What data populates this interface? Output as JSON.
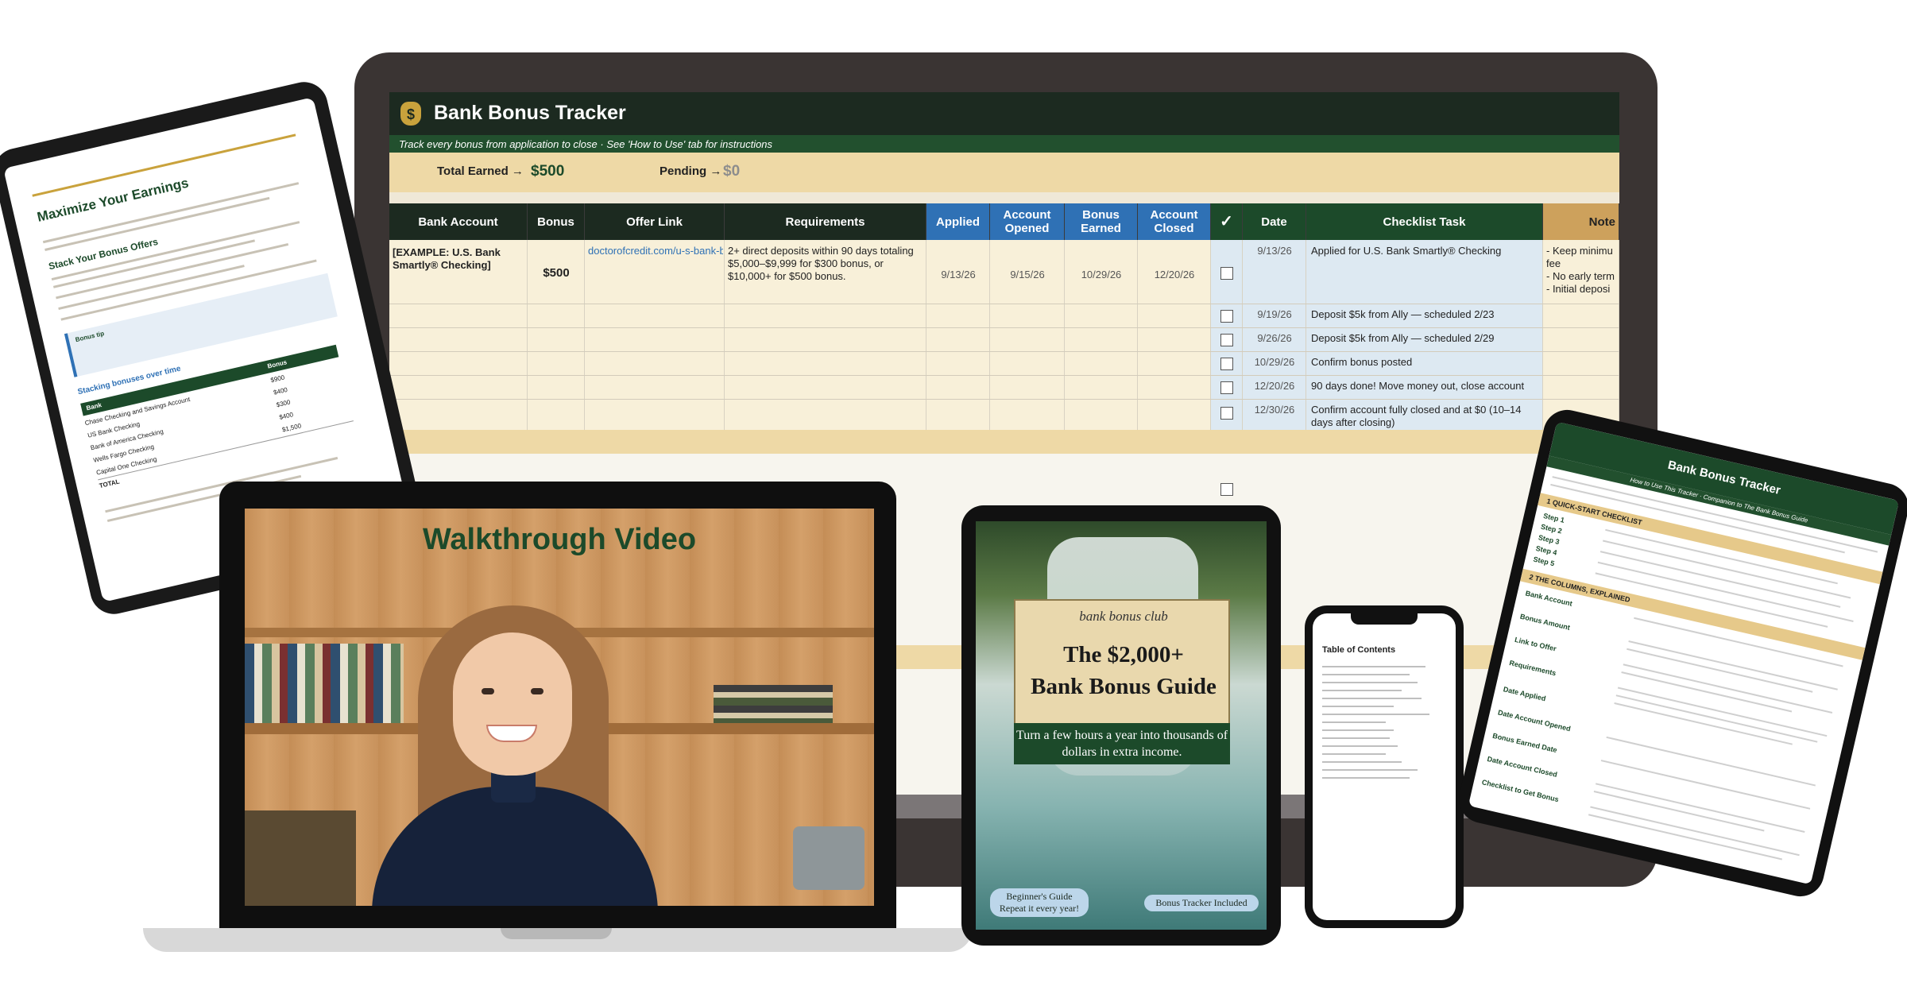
{
  "tracker": {
    "title": "Bank Bonus Tracker",
    "subtitle": "Track every bonus from application to close  ·  See 'How to Use' tab for instructions",
    "total_earned_label": "Total Earned →",
    "total_earned_value": "$500",
    "pending_label": "Pending →",
    "pending_value": "$0",
    "headers": {
      "bank_account": "Bank Account",
      "bonus": "Bonus",
      "offer_link": "Offer Link",
      "requirements": "Requirements",
      "applied": "Applied",
      "account_opened": "Account Opened",
      "bonus_earned": "Bonus Earned",
      "account_closed": "Account Closed",
      "check": "✓",
      "date": "Date",
      "checklist_task": "Checklist Task",
      "notes": "Note"
    },
    "example_row": {
      "bank_account": "[EXAMPLE: U.S. Bank Smartly® Checking]",
      "bonus": "$500",
      "offer_link": "doctorofcredit.com/u-s-bank-b",
      "requirements": "2+ direct deposits within 90 days totaling $5,000–$9,999 for $300 bonus, or $10,000+ for $500 bonus.",
      "applied": "9/13/26",
      "account_opened": "9/15/26",
      "bonus_earned": "10/29/26",
      "account_closed": "12/20/26",
      "notes": "- Keep minimu\nfee\n- No early term\n- Initial deposi"
    },
    "checklist": [
      {
        "date": "9/13/26",
        "task": "Applied for U.S. Bank Smartly® Checking"
      },
      {
        "date": "9/19/26",
        "task": "Deposit $5k from Ally — scheduled 2/23"
      },
      {
        "date": "9/26/26",
        "task": "Deposit $5k from Ally — scheduled 2/29"
      },
      {
        "date": "10/29/26",
        "task": "Confirm bonus posted"
      },
      {
        "date": "12/20/26",
        "task": "90 days done! Move money out, close account"
      },
      {
        "date": "12/30/26",
        "task": "Confirm account fully closed and at $0 (10–14 days after closing)"
      }
    ]
  },
  "guide_tablet": {
    "section": "Maximize Your Earnings",
    "subheading": "Stack Your Bonus Offers",
    "bonus_tip": "Bonus tip",
    "stacking": "Stacking bonuses over time",
    "table_head": [
      "Bank",
      "Bonus"
    ],
    "table_rows": [
      [
        "Chase Checking and Savings Account",
        "$900"
      ],
      [
        "US Bank Checking",
        "$400"
      ],
      [
        "Bank of America Checking",
        "$300"
      ],
      [
        "Wells Fargo Checking",
        "$400"
      ],
      [
        "Capital One Checking",
        "$1,500"
      ]
    ],
    "total": "TOTAL"
  },
  "video": {
    "title": "Walkthrough Video"
  },
  "ebook": {
    "club": "bank bonus club",
    "title_line1": "The $2,000+",
    "title_line2": "Bank Bonus Guide",
    "tagline": "Turn a few hours a year into thousands of dollars in extra income.",
    "pill_left": "Beginner's Guide Repeat it every year!",
    "pill_right": "Bonus Tracker Included"
  },
  "phone": {
    "toc_title": "Table of Contents"
  },
  "how_to_tablet": {
    "title": "Bank Bonus Tracker",
    "subtitle": "How to Use This Tracker · Companion to The Bank Bonus Guide",
    "quick_start": "1  QUICK-START CHECKLIST",
    "steps": [
      "Step 1",
      "Step 2",
      "Step 3",
      "Step 4",
      "Step 5"
    ],
    "columns_explained": "2  THE COLUMNS, EXPLAINED",
    "columns": [
      "Bank Account",
      "Bonus Amount",
      "Link to Offer",
      "Requirements",
      "Date Applied",
      "Date Account Opened",
      "Bonus Earned Date",
      "Date Account Closed",
      "Checklist to Get Bonus"
    ]
  }
}
